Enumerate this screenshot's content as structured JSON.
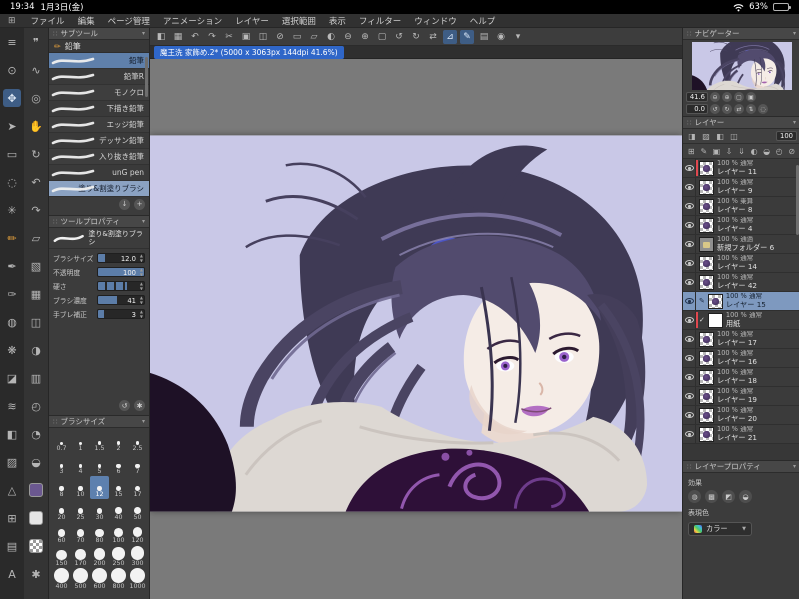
{
  "status_bar": {
    "time": "19:34",
    "date": "1月3日(金)",
    "battery_percent": "63%"
  },
  "menu_bar": {
    "items": [
      {
        "name": "menu-file",
        "label": "ファイル"
      },
      {
        "name": "menu-edit",
        "label": "編集"
      },
      {
        "name": "menu-page-manage",
        "label": "ページ管理"
      },
      {
        "name": "menu-animation",
        "label": "アニメーション"
      },
      {
        "name": "menu-layer",
        "label": "レイヤー"
      },
      {
        "name": "menu-selection",
        "label": "選択範囲"
      },
      {
        "name": "menu-view",
        "label": "表示"
      },
      {
        "name": "menu-filter",
        "label": "フィルター"
      },
      {
        "name": "menu-window",
        "label": "ウィンドウ"
      },
      {
        "name": "menu-help",
        "label": "ヘルプ"
      }
    ]
  },
  "toolbar": {
    "tools": [
      {
        "name": "main-menu-button",
        "glyph": "≡"
      },
      {
        "name": "zoom-tool",
        "glyph": "⊙"
      },
      {
        "name": "move-tool",
        "glyph": "✥",
        "state": "active"
      },
      {
        "name": "object-tool",
        "glyph": "➤"
      },
      {
        "name": "marquee-select-tool",
        "glyph": "▭"
      },
      {
        "name": "lasso-select-tool",
        "glyph": "◌"
      },
      {
        "name": "auto-select-tool",
        "glyph": "✳"
      },
      {
        "name": "pencil-tool",
        "glyph": "✏",
        "state": "accent"
      },
      {
        "name": "pen-tool",
        "glyph": "✒"
      },
      {
        "name": "brush-tool",
        "glyph": "✑"
      },
      {
        "name": "airbrush-tool",
        "glyph": "◍"
      },
      {
        "name": "decoration-tool",
        "glyph": "❋"
      },
      {
        "name": "eraser-tool",
        "glyph": "◪"
      },
      {
        "name": "blend-tool",
        "glyph": "≋"
      },
      {
        "name": "fill-tool",
        "glyph": "◧"
      },
      {
        "name": "gradient-tool",
        "glyph": "▨"
      },
      {
        "name": "figure-tool",
        "glyph": "△"
      },
      {
        "name": "frame-border-tool",
        "glyph": "⊞"
      },
      {
        "name": "ruler-tool",
        "glyph": "▤"
      },
      {
        "name": "text-tool",
        "glyph": "A"
      },
      {
        "name": "balloon-tool",
        "glyph": "❞"
      },
      {
        "name": "line-correction-tool",
        "glyph": "∿"
      },
      {
        "name": "eyedropper-tool",
        "glyph": "◎"
      },
      {
        "name": "hand-tool",
        "glyph": "✋"
      },
      {
        "name": "rotate-view-tool",
        "glyph": "↻"
      },
      {
        "name": "undo-button",
        "glyph": "↶"
      },
      {
        "name": "redo-button",
        "glyph": "↷"
      },
      {
        "name": "transform-button",
        "glyph": "▱"
      },
      {
        "name": "selection-area-button",
        "glyph": "▧"
      },
      {
        "name": "grid-button",
        "glyph": "▦"
      },
      {
        "name": "snap-button",
        "glyph": "◫"
      },
      {
        "name": "mirror-button",
        "glyph": "◑"
      },
      {
        "name": "material-button",
        "glyph": "▥"
      },
      {
        "name": "timeline-button",
        "glyph": "◴"
      },
      {
        "name": "onion-skin-button",
        "glyph": "◔"
      },
      {
        "name": "color-history-button",
        "glyph": "◒"
      },
      {
        "name": "main-color-swatch",
        "glyph": "",
        "type": "swatch-main"
      },
      {
        "name": "sub-color-swatch",
        "glyph": "",
        "type": "swatch-sub"
      },
      {
        "name": "transparent-color-swatch",
        "glyph": "",
        "type": "swatch-trans"
      },
      {
        "name": "settings-button",
        "glyph": "✱"
      }
    ]
  },
  "canvas_toolbar": {
    "icons": [
      {
        "name": "collapse-panels-button",
        "glyph": "◧"
      },
      {
        "name": "workspace-button",
        "glyph": "▦"
      },
      {
        "name": "undo-button",
        "glyph": "↶"
      },
      {
        "name": "redo-button",
        "glyph": "↷"
      },
      {
        "name": "cut-button",
        "glyph": "✂"
      },
      {
        "name": "copy-button",
        "glyph": "▣"
      },
      {
        "name": "paste-button",
        "glyph": "◫"
      },
      {
        "name": "delete-button",
        "glyph": "⊘"
      },
      {
        "name": "select-all-button",
        "glyph": "▭"
      },
      {
        "name": "deselect-button",
        "glyph": "▱"
      },
      {
        "name": "invert-selection-button",
        "glyph": "◐"
      },
      {
        "name": "zoom-out-button",
        "glyph": "⊖"
      },
      {
        "name": "zoom-in-button",
        "glyph": "⊕"
      },
      {
        "name": "fit-screen-button",
        "glyph": "▢"
      },
      {
        "name": "rotate-left-button",
        "glyph": "↺"
      },
      {
        "name": "rotate-right-button",
        "glyph": "↻"
      },
      {
        "name": "flip-horizontal-button",
        "glyph": "⇄"
      },
      {
        "name": "snap-ruler-button",
        "glyph": "⊿",
        "state": "active"
      },
      {
        "name": "draw-mode-button",
        "glyph": "✎",
        "state": "active"
      },
      {
        "name": "material-palette-button",
        "glyph": "▤"
      },
      {
        "name": "color-picker-button",
        "glyph": "◉"
      },
      {
        "name": "toolbar-overflow-button",
        "glyph": "▾"
      }
    ]
  },
  "document": {
    "tab_title": "魔王洗 家飾め.2* (5000 x 3063px 144dpi 41.6%)"
  },
  "subtool_panel": {
    "title": "サブツール",
    "group_label": "鉛筆",
    "brushes": [
      {
        "name": "鉛筆",
        "state": "active"
      },
      {
        "name": "鉛筆R"
      },
      {
        "name": "モノクロ"
      },
      {
        "name": "下描き鉛筆"
      },
      {
        "name": "エッジ鉛筆"
      },
      {
        "name": "デッサン鉛筆"
      },
      {
        "name": "入り抜き鉛筆"
      },
      {
        "name": "unG pen"
      },
      {
        "name": "塗り&割塗りブラシ",
        "state": "selected"
      }
    ]
  },
  "tool_property_panel": {
    "title": "ツールプロパティ",
    "tool_name": "塗り&割塗りブラシ",
    "params": [
      {
        "label": "ブラシサイズ",
        "value": "12.0",
        "fill": 15
      },
      {
        "label": "不透明度",
        "value": "100",
        "fill": 100
      },
      {
        "label": "硬さ",
        "value": "",
        "fill": 62,
        "type": "seg"
      },
      {
        "label": "ブラシ濃度",
        "value": "41",
        "fill": 41
      },
      {
        "label": "手ブレ補正",
        "value": "3",
        "fill": 12
      }
    ]
  },
  "brush_size_panel": {
    "title": "ブラシサイズ",
    "sizes": [
      {
        "value": "0.7"
      },
      {
        "value": "1"
      },
      {
        "value": "1.5"
      },
      {
        "value": "2"
      },
      {
        "value": "2.5"
      },
      {
        "value": "3"
      },
      {
        "value": "4"
      },
      {
        "value": "5"
      },
      {
        "value": "6"
      },
      {
        "value": "7"
      },
      {
        "value": "8"
      },
      {
        "value": "10"
      },
      {
        "value": "12",
        "state": "selected"
      },
      {
        "value": "15"
      },
      {
        "value": "17"
      },
      {
        "value": "20"
      },
      {
        "value": "25"
      },
      {
        "value": "30"
      },
      {
        "value": "40"
      },
      {
        "value": "50"
      },
      {
        "value": "60"
      },
      {
        "value": "70"
      },
      {
        "value": "80"
      },
      {
        "value": "100"
      },
      {
        "value": "120"
      },
      {
        "value": "150"
      },
      {
        "value": "170"
      },
      {
        "value": "200"
      },
      {
        "value": "250"
      },
      {
        "value": "300"
      },
      {
        "value": "400"
      },
      {
        "value": "500"
      },
      {
        "value": "600"
      },
      {
        "value": "800"
      },
      {
        "value": "1000"
      }
    ]
  },
  "navigator_panel": {
    "title": "ナビゲーター",
    "zoom_value": "41.6",
    "rotation_value": "0.0",
    "zoom_icons": [
      {
        "name": "zoom-out-button",
        "glyph": "⊖"
      },
      {
        "name": "zoom-in-button",
        "glyph": "⊕"
      },
      {
        "name": "fit-to-screen-button",
        "glyph": "▢"
      },
      {
        "name": "actual-size-button",
        "glyph": "▣"
      }
    ],
    "rotate_icons": [
      {
        "name": "rotate-left-button",
        "glyph": "↺"
      },
      {
        "name": "rotate-right-button",
        "glyph": "↻"
      },
      {
        "name": "flip-horizontal-button",
        "glyph": "⇄"
      },
      {
        "name": "flip-vertical-button",
        "glyph": "⇅"
      },
      {
        "name": "reset-view-button",
        "glyph": "◌"
      }
    ]
  },
  "layer_panel": {
    "title": "レイヤー",
    "opacity_value": "100",
    "mode_icons": [
      {
        "name": "blend-mode-button",
        "glyph": "◨"
      },
      {
        "name": "lock-alpha-button",
        "glyph": "▨"
      },
      {
        "name": "clip-to-layer-button",
        "glyph": "◧"
      },
      {
        "name": "lock-layer-button",
        "glyph": "◫"
      }
    ],
    "action_icons": [
      {
        "name": "new-raster-layer-button",
        "glyph": "⊞"
      },
      {
        "name": "new-vector-layer-button",
        "glyph": "✎"
      },
      {
        "name": "new-folder-button",
        "glyph": "▣"
      },
      {
        "name": "transfer-down-button",
        "glyph": "⇩"
      },
      {
        "name": "merge-down-button",
        "glyph": "⇓"
      },
      {
        "name": "layer-mask-button",
        "glyph": "◐"
      },
      {
        "name": "apply-mask-button",
        "glyph": "◒"
      },
      {
        "name": "two-pane-button",
        "glyph": "◴"
      },
      {
        "name": "delete-layer-button",
        "glyph": "⊘"
      }
    ],
    "layers": [
      {
        "opacity": "100 %",
        "mode": "通常",
        "name": "レイヤー 11",
        "clip": true
      },
      {
        "opacity": "100 %",
        "mode": "通常",
        "name": "レイヤー 9"
      },
      {
        "opacity": "100 %",
        "mode": "乗算",
        "name": "レイヤー 8"
      },
      {
        "opacity": "100 %",
        "mode": "通常",
        "name": "レイヤー 4"
      },
      {
        "opacity": "100 %",
        "mode": "通過",
        "name": "新規フォルダー 6",
        "type": "folder"
      },
      {
        "opacity": "100 %",
        "mode": "通常",
        "name": "レイヤー 14"
      },
      {
        "opacity": "100 %",
        "mode": "通常",
        "name": "レイヤー 42"
      },
      {
        "opacity": "100 %",
        "mode": "通常",
        "name": "レイヤー 15",
        "state": "selected"
      },
      {
        "opacity": "100 %",
        "mode": "通常",
        "name": "用紙",
        "type": "paper",
        "clip": true
      },
      {
        "opacity": "100 %",
        "mode": "通常",
        "name": "レイヤー 17"
      },
      {
        "opacity": "100 %",
        "mode": "通常",
        "name": "レイヤー 16"
      },
      {
        "opacity": "100 %",
        "mode": "通常",
        "name": "レイヤー 18"
      },
      {
        "opacity": "100 %",
        "mode": "通常",
        "name": "レイヤー 19"
      },
      {
        "opacity": "100 %",
        "mode": "通常",
        "name": "レイヤー 20"
      },
      {
        "opacity": "100 %",
        "mode": "通常",
        "name": "レイヤー 21"
      }
    ]
  },
  "layer_property_panel": {
    "title": "レイヤープロパティ",
    "effect_label": "効果",
    "effect_icons": [
      {
        "name": "border-effect-button",
        "glyph": "◍"
      },
      {
        "name": "tone-effect-button",
        "glyph": "▩"
      },
      {
        "name": "layer-color-button",
        "glyph": "◩"
      },
      {
        "name": "extract-line-button",
        "glyph": "◒"
      }
    ],
    "color_label": "表現色",
    "color_mode": "カラー"
  }
}
